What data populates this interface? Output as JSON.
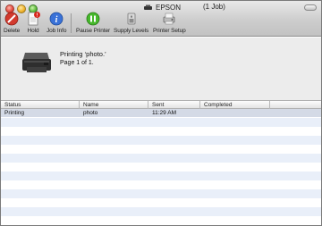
{
  "window": {
    "title": "EPSON",
    "job_count": "(1 Job)"
  },
  "toolbar": {
    "delete_label": "Delete",
    "hold_label": "Hold",
    "hold_badge": "!",
    "job_info_label": "Job Info",
    "pause_printer_label": "Pause Printer",
    "supply_levels_label": "Supply Levels",
    "printer_setup_label": "Printer Setup"
  },
  "status": {
    "line1": "Printing ‘photo.’",
    "line2": "Page 1 of 1."
  },
  "table": {
    "columns": [
      "Status",
      "Name",
      "Sent",
      "Completed"
    ],
    "rows": [
      {
        "status": "Printing",
        "name": "photo",
        "sent": "11:29 AM",
        "completed": ""
      }
    ]
  },
  "colors": {
    "selected_row": "#d4dae6",
    "alt_row": "#e9eff9",
    "delete_red": "#d23a2e",
    "pause_green": "#46b82c",
    "info_blue": "#3a72d8"
  }
}
